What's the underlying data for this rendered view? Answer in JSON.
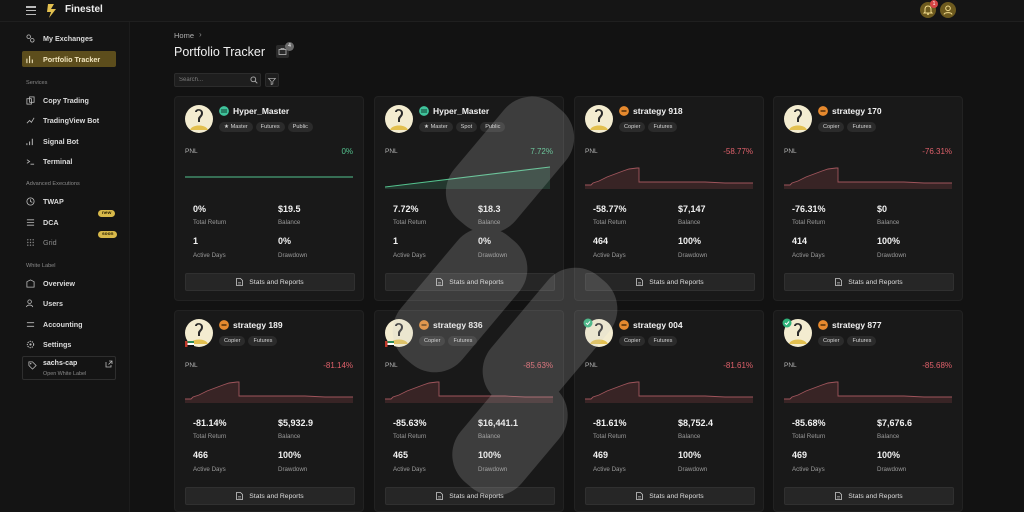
{
  "app": {
    "brand": "Finestel"
  },
  "notifications": {
    "count": "1"
  },
  "sidebar": {
    "top_items": [
      {
        "label": "My Exchanges"
      },
      {
        "label": "Portfolio Tracker"
      }
    ],
    "services_label": "Services",
    "service_items": [
      {
        "label": "Copy Trading"
      },
      {
        "label": "TradingView Bot"
      },
      {
        "label": "Signal Bot"
      },
      {
        "label": "Terminal"
      }
    ],
    "advanced_label": "Advanced Executions",
    "advanced_items": [
      {
        "label": "TWAP"
      },
      {
        "label": "DCA",
        "badge": "new"
      },
      {
        "label": "Grid",
        "badge": "soon"
      }
    ],
    "white_label_label": "White Label",
    "white_label_items": [
      {
        "label": "Overview"
      },
      {
        "label": "Users"
      },
      {
        "label": "Accounting"
      },
      {
        "label": "Settings"
      }
    ],
    "white_label_box": {
      "name": "sachs-cap",
      "sub": "Open White Label"
    }
  },
  "main": {
    "breadcrumb": "Home",
    "breadcrumb_sep": "›",
    "title": "Portfolio Tracker",
    "title_count": "4",
    "search_placeholder": "Search..."
  },
  "labels": {
    "pnl": "PNL",
    "total_return": "Total Return",
    "balance": "Balance",
    "active_days": "Active Days",
    "drawdown": "Drawdown",
    "stats_button": "Stats and Reports"
  },
  "colors": {
    "accent": "#5c4d1c",
    "positive": "#54c28e",
    "negative": "#e0616b",
    "copier_icon": "#e6892e",
    "master_icon": "#3fc29a"
  },
  "cards": [
    {
      "name": "Hyper_Master",
      "kind": "master",
      "tags": [
        "★ Master",
        "Futures",
        "Public"
      ],
      "pnl": "0%",
      "trend": "flat",
      "total_return": "0%",
      "balance": "$19.5",
      "active_days": "1",
      "drawdown": "0%"
    },
    {
      "name": "Hyper_Master",
      "kind": "master",
      "tags": [
        "★ Master",
        "Spot",
        "Public"
      ],
      "pnl": "7.72%",
      "trend": "up",
      "total_return": "7.72%",
      "balance": "$18.3",
      "active_days": "1",
      "drawdown": "0%"
    },
    {
      "name": "strategy 918",
      "kind": "copier",
      "tags": [
        "Copier",
        "Futures"
      ],
      "pnl": "-58.77%",
      "trend": "down",
      "total_return": "-58.77%",
      "balance": "$7,147",
      "active_days": "464",
      "drawdown": "100%"
    },
    {
      "name": "strategy 170",
      "kind": "copier",
      "tags": [
        "Copier",
        "Futures"
      ],
      "pnl": "-76.31%",
      "trend": "down",
      "total_return": "-76.31%",
      "balance": "$0",
      "active_days": "414",
      "drawdown": "100%"
    },
    {
      "name": "strategy 189",
      "kind": "copier",
      "flag": true,
      "tags": [
        "Copier",
        "Futures"
      ],
      "pnl": "-81.14%",
      "trend": "down",
      "total_return": "-81.14%",
      "balance": "$5,932.9",
      "active_days": "466",
      "drawdown": "100%"
    },
    {
      "name": "strategy 836",
      "kind": "copier",
      "flag": true,
      "tags": [
        "Copier",
        "Futures"
      ],
      "pnl": "-85.63%",
      "trend": "down",
      "total_return": "-85.63%",
      "balance": "$16,441.1",
      "active_days": "465",
      "drawdown": "100%"
    },
    {
      "name": "strategy 004",
      "kind": "copier",
      "status": true,
      "tags": [
        "Copier",
        "Futures"
      ],
      "pnl": "-81.61%",
      "trend": "down",
      "total_return": "-81.61%",
      "balance": "$8,752.4",
      "active_days": "469",
      "drawdown": "100%"
    },
    {
      "name": "strategy 877",
      "kind": "copier",
      "status": true,
      "tags": [
        "Copier",
        "Futures"
      ],
      "pnl": "-85.68%",
      "trend": "down",
      "total_return": "-85.68%",
      "balance": "$7,676.6",
      "active_days": "469",
      "drawdown": "100%"
    }
  ]
}
